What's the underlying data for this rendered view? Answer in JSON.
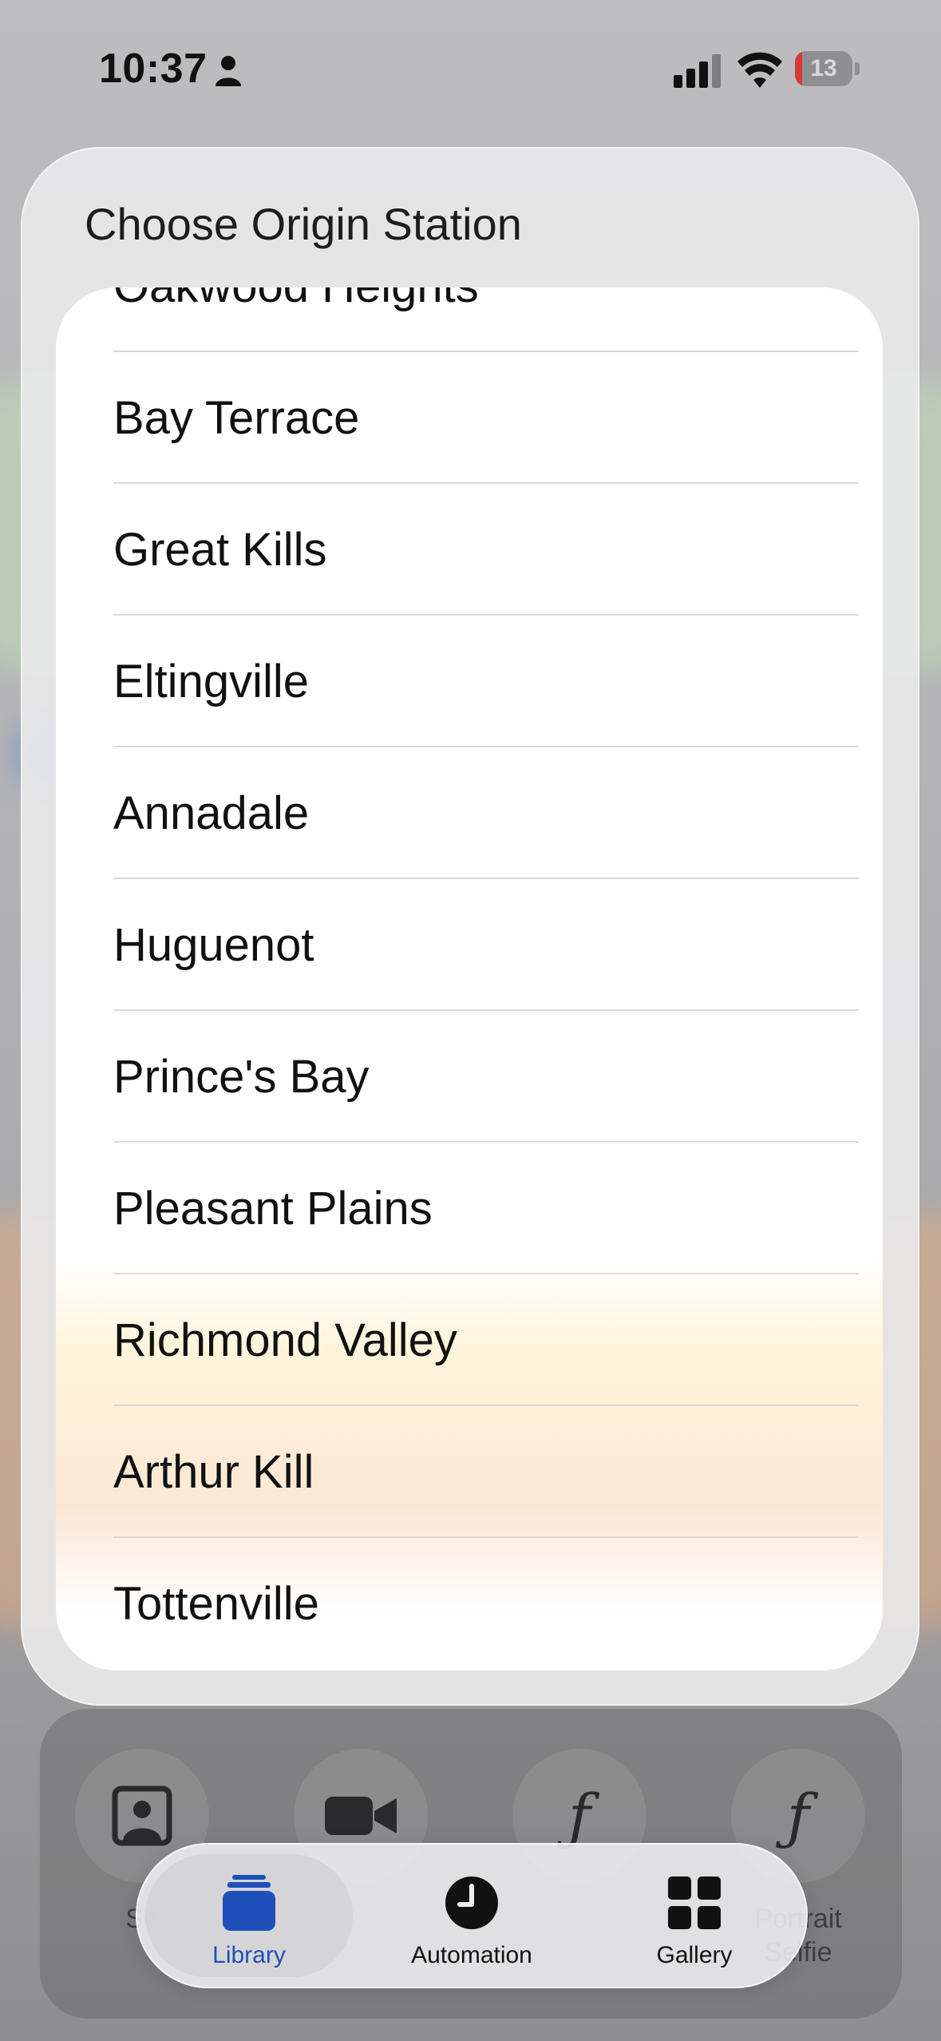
{
  "status_bar": {
    "time": "10:37",
    "battery_level": "13",
    "battery_color": "#d43a36"
  },
  "sheet": {
    "title": "Choose Origin Station",
    "stations": [
      "Oakwood Heights",
      "Bay Terrace",
      "Great Kills",
      "Eltingville",
      "Annadale",
      "Huguenot",
      "Prince's Bay",
      "Pleasant Plains",
      "Richmond Valley",
      "Arthur Kill",
      "Tottenville"
    ]
  },
  "tray": {
    "items": [
      {
        "icon": "person-portrait-icon",
        "label": "Se"
      },
      {
        "icon": "video-camera-icon",
        "label": ""
      },
      {
        "icon": "function-icon",
        "label": ""
      },
      {
        "icon": "function-icon",
        "label": "Portrait\nSelfie"
      }
    ]
  },
  "tab_bar": {
    "accent": "#1f4fb8",
    "tabs": [
      {
        "label": "Library",
        "icon": "stack-icon",
        "active": true
      },
      {
        "label": "Automation",
        "icon": "clock-icon",
        "active": false
      },
      {
        "label": "Gallery",
        "icon": "grid-icon",
        "active": false
      }
    ]
  }
}
